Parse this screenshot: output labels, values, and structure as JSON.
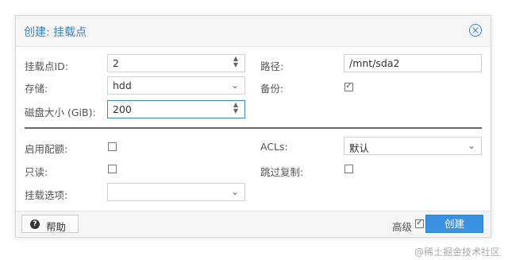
{
  "dialog": {
    "title": "创建: 挂载点",
    "close_icon": "close-icon"
  },
  "form": {
    "mount_id": {
      "label": "挂载点ID:",
      "value": "2"
    },
    "storage": {
      "label": "存储:",
      "value": "hdd"
    },
    "disk_size": {
      "label": "磁盘大小 (GiB):",
      "value": "200"
    },
    "path": {
      "label": "路径:",
      "value": "/mnt/sda2"
    },
    "backup": {
      "label": "备份:",
      "checked": true
    },
    "enable_quota": {
      "label": "启用配额:",
      "checked": false
    },
    "readonly": {
      "label": "只读:",
      "checked": false
    },
    "mount_options": {
      "label": "挂载选项:",
      "value": ""
    },
    "acls": {
      "label": "ACLs:",
      "value": "默认"
    },
    "skip_replication": {
      "label": "跳过复制:",
      "checked": false
    }
  },
  "footer": {
    "help_label": "帮助",
    "advanced_label": "高级",
    "advanced_checked": true,
    "create_label": "创建"
  },
  "watermark": "@稀土掘金技术社区",
  "colors": {
    "accent": "#3d84c6",
    "primary_button": "#3892e0"
  }
}
